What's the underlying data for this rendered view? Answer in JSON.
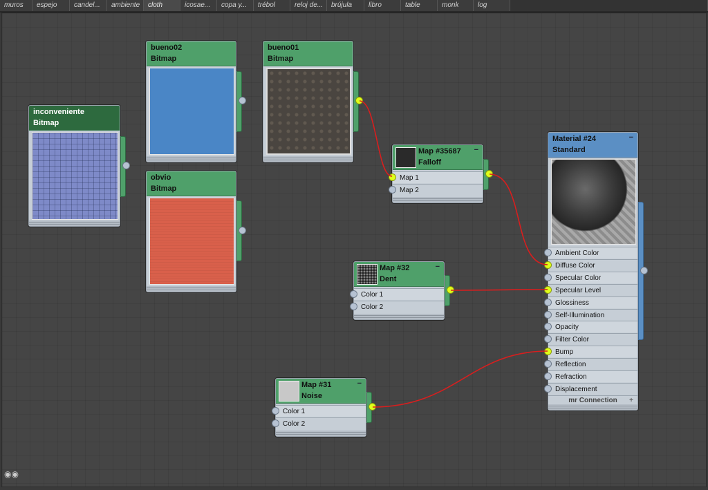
{
  "tabs": [
    "muros",
    "espejo",
    "candel...",
    "ambiente",
    "cloth",
    "icosae...",
    "copa y...",
    "trébol",
    "reloj de...",
    "brújula",
    "libro",
    "table",
    "monk",
    "log"
  ],
  "active_tab": "cloth",
  "nodes": {
    "inconveniente": {
      "name": "inconveniente",
      "type": "Bitmap",
      "color": "#7a86c6"
    },
    "bueno02": {
      "name": "bueno02",
      "type": "Bitmap",
      "color": "#4a86c6"
    },
    "bueno01": {
      "name": "bueno01",
      "type": "Bitmap",
      "color": "#4a4540"
    },
    "obvio": {
      "name": "obvio",
      "type": "Bitmap",
      "color": "#d9604b"
    },
    "falloff": {
      "name": "Map #35687",
      "type": "Falloff",
      "slots": [
        "Map 1",
        "Map 2"
      ]
    },
    "dent": {
      "name": "Map #32",
      "type": "Dent",
      "slots": [
        "Color 1",
        "Color 2"
      ]
    },
    "noise": {
      "name": "Map #31",
      "type": "Noise",
      "slots": [
        "Color 1",
        "Color 2"
      ]
    },
    "material": {
      "name": "Material #24",
      "type": "Standard",
      "slots": [
        "Ambient Color",
        "Diffuse Color",
        "Specular Color",
        "Specular Level",
        "Glossiness",
        "Self-Illumination",
        "Opacity",
        "Filter Color",
        "Bump",
        "Reflection",
        "Refraction",
        "Displacement"
      ],
      "connected_slots": [
        "Diffuse Color",
        "Specular Level",
        "Bump"
      ],
      "footer": "mr Connection"
    }
  },
  "colors": {
    "wire": "#d81e1e",
    "connected_dot": "#e0ff1a",
    "bitmap_header": "#4fa06a",
    "standard_header": "#5b8fc4"
  }
}
